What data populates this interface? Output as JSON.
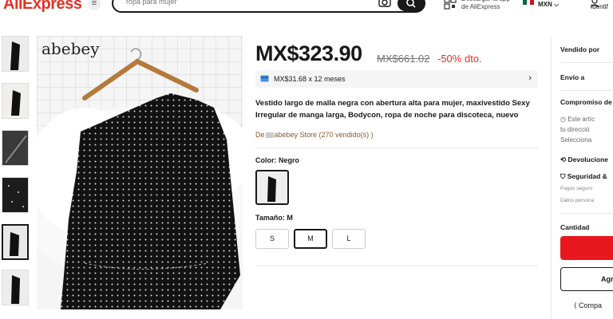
{
  "header": {
    "logo": "AliExpress",
    "search_placeholder": "ropa para mujer",
    "app_text": "Descargar la app de AliExpress",
    "currency": "MXN ⌵",
    "user_text": "Identif"
  },
  "product": {
    "brand_watermark": "abebey",
    "price": "MX$323.90",
    "old_price": "MX$661.02",
    "discount": "-50% dto.",
    "installments": "MX$31.68 x 12 meses",
    "title": "Vestido largo de malla negra con abertura alta para mujer, maxivestido Sexy Irregular de manga larga, Bodycon, ropa de noche para discoteca, nuevo",
    "store_prefix": "De",
    "store_name": "abebey Store (270 vendido(s) )",
    "color_label": "Color: Negro",
    "size_label": "Tamaño: M",
    "sizes": [
      "S",
      "M",
      "L"
    ],
    "selected_size": "M"
  },
  "right_panel": {
    "sold_by": "Vendido por",
    "ship_to": "Envío a",
    "commitment": "Compromiso de",
    "commit_line1": "Este artíc",
    "commit_line2": "tu direcció",
    "commit_line3": "Selecciona",
    "returns": "Devolucione",
    "security": "Seguridad &",
    "payments": "Pagos seguro",
    "personal_data": "Datos persona",
    "quantity": "Cantidad",
    "add_cart": "Agr",
    "share": "Compa"
  },
  "colors": {
    "brand_red": "#e43225",
    "buy_red": "#e8171e",
    "store_brown": "#8a5a2b"
  }
}
